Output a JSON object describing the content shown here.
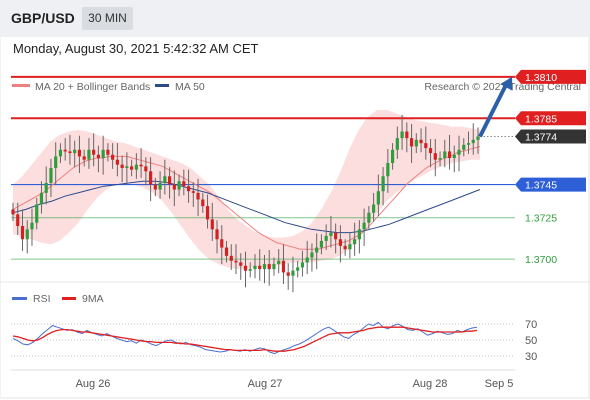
{
  "header": {
    "symbol": "GBP/USD",
    "timeframe": "30 MIN"
  },
  "datetime": "Monday, August 30, 2021 5:42:32 AM CET",
  "copyright": "Research © 2021 Trading Central",
  "colors": {
    "resistance": "#e02020",
    "support_blue": "#2e5fd6",
    "support_green": "#2e9e3c",
    "ma20": "#f08080",
    "ma50": "#2b4a8c",
    "bollinger_fill": "#fbd8d8",
    "candle_up": "#2e9e3c",
    "candle_down": "#d42020",
    "rsi": "#4a6fd1",
    "rsi_ma": "#e02020",
    "arrow": "#2b5fa8",
    "current_label": "#333333"
  },
  "chart_data": [
    {
      "type": "candlestick",
      "legend": [
        "MA 20 + Bollinger Bands",
        "MA 50"
      ],
      "x_ticks": [
        "Aug 26",
        "Aug 27",
        "Aug 28",
        "Sep 5"
      ],
      "ylim": [
        1.3685,
        1.3825
      ],
      "levels": [
        {
          "value": 1.381,
          "label": "1.3810",
          "kind": "resistance"
        },
        {
          "value": 1.3785,
          "label": "1.3785",
          "kind": "resistance"
        },
        {
          "value": 1.3774,
          "label": "1.3774",
          "kind": "current"
        },
        {
          "value": 1.3745,
          "label": "1.3745",
          "kind": "pivot"
        },
        {
          "value": 1.3725,
          "label": "1.3725",
          "kind": "support"
        },
        {
          "value": 1.37,
          "label": "1.3700",
          "kind": "support"
        }
      ],
      "close": [
        1.3727,
        1.372,
        1.3712,
        1.3718,
        1.3722,
        1.3733,
        1.374,
        1.3746,
        1.3755,
        1.3762,
        1.3766,
        1.3765,
        1.3764,
        1.3766,
        1.3762,
        1.376,
        1.3766,
        1.3763,
        1.3761,
        1.3766,
        1.3763,
        1.376,
        1.3757,
        1.3755,
        1.3756,
        1.3754,
        1.3757,
        1.3756,
        1.3753,
        1.3745,
        1.3742,
        1.3746,
        1.375,
        1.3745,
        1.3742,
        1.3747,
        1.3744,
        1.3741,
        1.374,
        1.3736,
        1.3732,
        1.3724,
        1.3718,
        1.3712,
        1.3707,
        1.3702,
        1.3699,
        1.3698,
        1.3696,
        1.3693,
        1.3694,
        1.3696,
        1.3694,
        1.3697,
        1.3694,
        1.3697,
        1.3699,
        1.3692,
        1.369,
        1.3693,
        1.3695,
        1.3698,
        1.3701,
        1.3704,
        1.3707,
        1.3711,
        1.3714,
        1.3716,
        1.3712,
        1.3708,
        1.3706,
        1.3709,
        1.3712,
        1.3718,
        1.3722,
        1.3728,
        1.3733,
        1.3741,
        1.375,
        1.3758,
        1.3766,
        1.3773,
        1.3777,
        1.3773,
        1.3768,
        1.3772,
        1.377,
        1.3767,
        1.3764,
        1.376,
        1.3761,
        1.3765,
        1.3761,
        1.3763,
        1.3766,
        1.3769,
        1.377,
        1.3772,
        1.3774
      ],
      "ma20": [
        1.373,
        1.3732,
        1.3734,
        1.3736,
        1.3738,
        1.374,
        1.3743,
        1.3746,
        1.3749,
        1.3752,
        1.3755,
        1.3757,
        1.3759,
        1.376,
        1.3761,
        1.3761,
        1.3762,
        1.3762,
        1.3762,
        1.3762,
        1.3761,
        1.376,
        1.3759,
        1.3758,
        1.3757,
        1.3756,
        1.3754,
        1.3752,
        1.375,
        1.3748,
        1.3746,
        1.3744,
        1.3742,
        1.374,
        1.3737,
        1.3734,
        1.3731,
        1.3728,
        1.3725,
        1.3722,
        1.3719,
        1.3716,
        1.3714,
        1.3712,
        1.371,
        1.3709,
        1.3708,
        1.3707,
        1.3706,
        1.3706,
        1.3706,
        1.3706,
        1.3707,
        1.3708,
        1.3709,
        1.371,
        1.3711,
        1.3713,
        1.3715,
        1.3718,
        1.3722,
        1.3726,
        1.373,
        1.3734,
        1.3738,
        1.3742,
        1.3746,
        1.3749,
        1.3752,
        1.3755,
        1.3757,
        1.3759,
        1.3761,
        1.3762,
        1.3764,
        1.3765,
        1.3766,
        1.3767,
        1.3768
      ],
      "ma50": [
        1.3728,
        1.373,
        1.3733,
        1.3735,
        1.3738,
        1.374,
        1.3742,
        1.3744,
        1.3745,
        1.3746,
        1.3747,
        1.3747,
        1.3746,
        1.3744,
        1.3742,
        1.374,
        1.3737,
        1.3734,
        1.3731,
        1.3728,
        1.3725,
        1.3722,
        1.372,
        1.3718,
        1.3717,
        1.3716,
        1.3716,
        1.3717,
        1.3719,
        1.3721,
        1.3724,
        1.3727,
        1.373,
        1.3733,
        1.3736,
        1.3739,
        1.3742
      ],
      "bb_upper": [
        1.3745,
        1.375,
        1.3757,
        1.3764,
        1.3771,
        1.3775,
        1.3777,
        1.3778,
        1.3777,
        1.3775,
        1.3773,
        1.3771,
        1.377,
        1.3768,
        1.3766,
        1.3764,
        1.3762,
        1.376,
        1.3758,
        1.3755,
        1.375,
        1.3745,
        1.3738,
        1.373,
        1.3724,
        1.372,
        1.3716,
        1.3714,
        1.3713,
        1.3713,
        1.3714,
        1.3717,
        1.3722,
        1.373,
        1.374,
        1.3752,
        1.3766,
        1.3778,
        1.3786,
        1.379,
        1.379,
        1.3788,
        1.3786,
        1.3784,
        1.3783,
        1.3782,
        1.3781,
        1.378,
        1.378,
        1.3779,
        1.3778
      ],
      "bb_lower": [
        1.3715,
        1.3714,
        1.3712,
        1.371,
        1.3709,
        1.3711,
        1.3716,
        1.3722,
        1.373,
        1.3737,
        1.3742,
        1.3745,
        1.3746,
        1.3745,
        1.3743,
        1.374,
        1.3735,
        1.3728,
        1.372,
        1.3712,
        1.3705,
        1.37,
        1.3697,
        1.3695,
        1.3694,
        1.3694,
        1.3695,
        1.3695,
        1.3696,
        1.3697,
        1.3698,
        1.3698,
        1.3698,
        1.3699,
        1.37,
        1.3702,
        1.3706,
        1.3712,
        1.372,
        1.3728,
        1.3735,
        1.374,
        1.3744,
        1.3748,
        1.3751,
        1.3754,
        1.3756,
        1.3758,
        1.3759,
        1.376,
        1.376
      ],
      "forecast_arrow": {
        "from": 1.3774,
        "to": 1.381
      }
    },
    {
      "type": "line",
      "legend": [
        "RSI",
        "9MA"
      ],
      "ylim": [
        20,
        80
      ],
      "y_ticks": [
        70,
        50,
        30
      ],
      "rsi": [
        52,
        49,
        45,
        44,
        47,
        52,
        58,
        63,
        68,
        66,
        64,
        62,
        63,
        60,
        58,
        62,
        59,
        57,
        55,
        58,
        55,
        52,
        50,
        48,
        49,
        46,
        50,
        48,
        45,
        43,
        46,
        49,
        50,
        47,
        45,
        47,
        44,
        43,
        41,
        38,
        37,
        36,
        35,
        36,
        38,
        37,
        36,
        38,
        36,
        38,
        40,
        39,
        35,
        33,
        36,
        38,
        40,
        43,
        45,
        48,
        52,
        56,
        60,
        64,
        66,
        62,
        58,
        54,
        52,
        57,
        60,
        65,
        70,
        68,
        72,
        66,
        64,
        68,
        70,
        67,
        63,
        62,
        64,
        60,
        56,
        58,
        61,
        59,
        57,
        58,
        62,
        60,
        63,
        65,
        66
      ],
      "rsi_ma": [
        55,
        54,
        52,
        50,
        49,
        50,
        53,
        57,
        60,
        62,
        63,
        63,
        62,
        61,
        60,
        60,
        59,
        58,
        57,
        56,
        55,
        54,
        53,
        52,
        51,
        50,
        49,
        48,
        48,
        47,
        47,
        47,
        47,
        46,
        46,
        45,
        45,
        44,
        43,
        42,
        41,
        40,
        39,
        38,
        38,
        37,
        37,
        37,
        37,
        37,
        37,
        38,
        37,
        36,
        36,
        36,
        37,
        38,
        40,
        42,
        45,
        48,
        51,
        54,
        57,
        58,
        59,
        59,
        59,
        60,
        61,
        62,
        64,
        65,
        66,
        66,
        66,
        66,
        66,
        66,
        65,
        64,
        63,
        62,
        61,
        60,
        60,
        60,
        60,
        60,
        60,
        60,
        61,
        61,
        62
      ]
    }
  ]
}
